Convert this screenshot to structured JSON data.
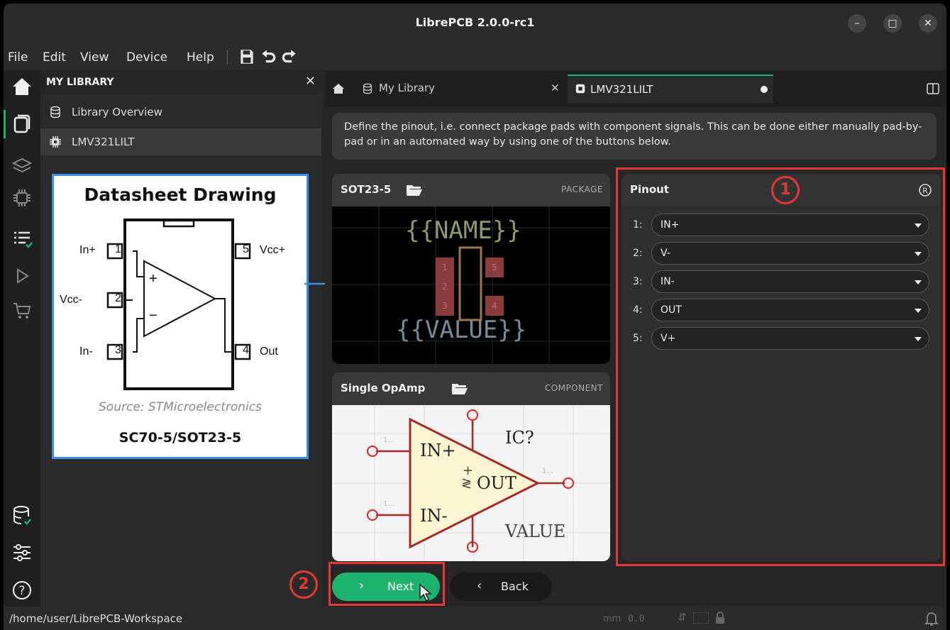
{
  "window": {
    "title": "LibrePCB 2.0.0-rc1"
  },
  "menu": {
    "items": [
      "File",
      "Edit",
      "View",
      "Device",
      "Help"
    ]
  },
  "library_panel": {
    "header": "MY LIBRARY",
    "items": [
      {
        "label": "Library Overview",
        "icon": "database-icon"
      },
      {
        "label": "LMV321LILT",
        "icon": "chip-icon"
      }
    ]
  },
  "datasheet": {
    "title": "Datasheet Drawing",
    "pins_left": [
      {
        "label": "In+",
        "num": "1"
      },
      {
        "label": "Vcc-",
        "num": "2"
      },
      {
        "label": "In-",
        "num": "3"
      }
    ],
    "pins_right": [
      {
        "label": "Vcc+",
        "num": "5"
      },
      {
        "label": "Out",
        "num": "4"
      }
    ],
    "plus": "+",
    "minus": "−",
    "source": "Source: STMicroelectronics",
    "package": "SC70-5/SOT23-5"
  },
  "tabs": [
    {
      "label": "My Library"
    },
    {
      "label": "LMV321LILT"
    }
  ],
  "info_text": "Define the pinout, i.e. connect package pads with component signals. This can be done either manually pad-by-pad or in an automated way by using one of the buttons below.",
  "package_card": {
    "title": "SOT23-5",
    "kind": "PACKAGE",
    "name_text": "{{NAME}}",
    "value_text": "{{VALUE}}",
    "pads": [
      "1",
      "2",
      "3",
      "4",
      "5"
    ]
  },
  "component_card": {
    "title": "Single OpAmp",
    "kind": "COMPONENT",
    "labels": {
      "in_plus": "IN+",
      "in_minus": "IN-",
      "out": "OUT",
      "refdes": "IC?",
      "value": "VALUE",
      "pin_hint_1": "1...",
      "pin_hint_2": "1...",
      "pin_hint_3": "1...",
      "plus": "+",
      "marks": "≷"
    }
  },
  "pinout": {
    "title": "Pinout",
    "reset_icon": "reset-icon",
    "rows": [
      {
        "num": "1:",
        "value": "IN+"
      },
      {
        "num": "2:",
        "value": "V-"
      },
      {
        "num": "3:",
        "value": "IN-"
      },
      {
        "num": "4:",
        "value": "OUT"
      },
      {
        "num": "5:",
        "value": "V+"
      }
    ]
  },
  "buttons": {
    "next": "Next",
    "back": "Back"
  },
  "annotations": {
    "one": "1",
    "two": "2"
  },
  "status": {
    "path": "/home/user/LibrePCB-Workspace",
    "unit": "mm",
    "value": "0.0"
  },
  "colors": {
    "accent": "#1db26d",
    "annotation": "#e53935",
    "datasheet_border": "#3b8fe0",
    "arrow": "#3b8fe0",
    "symbol_fill": "#fbf5d1",
    "symbol_stroke": "#a52a2a",
    "pad_color": "#8a3b3b"
  }
}
